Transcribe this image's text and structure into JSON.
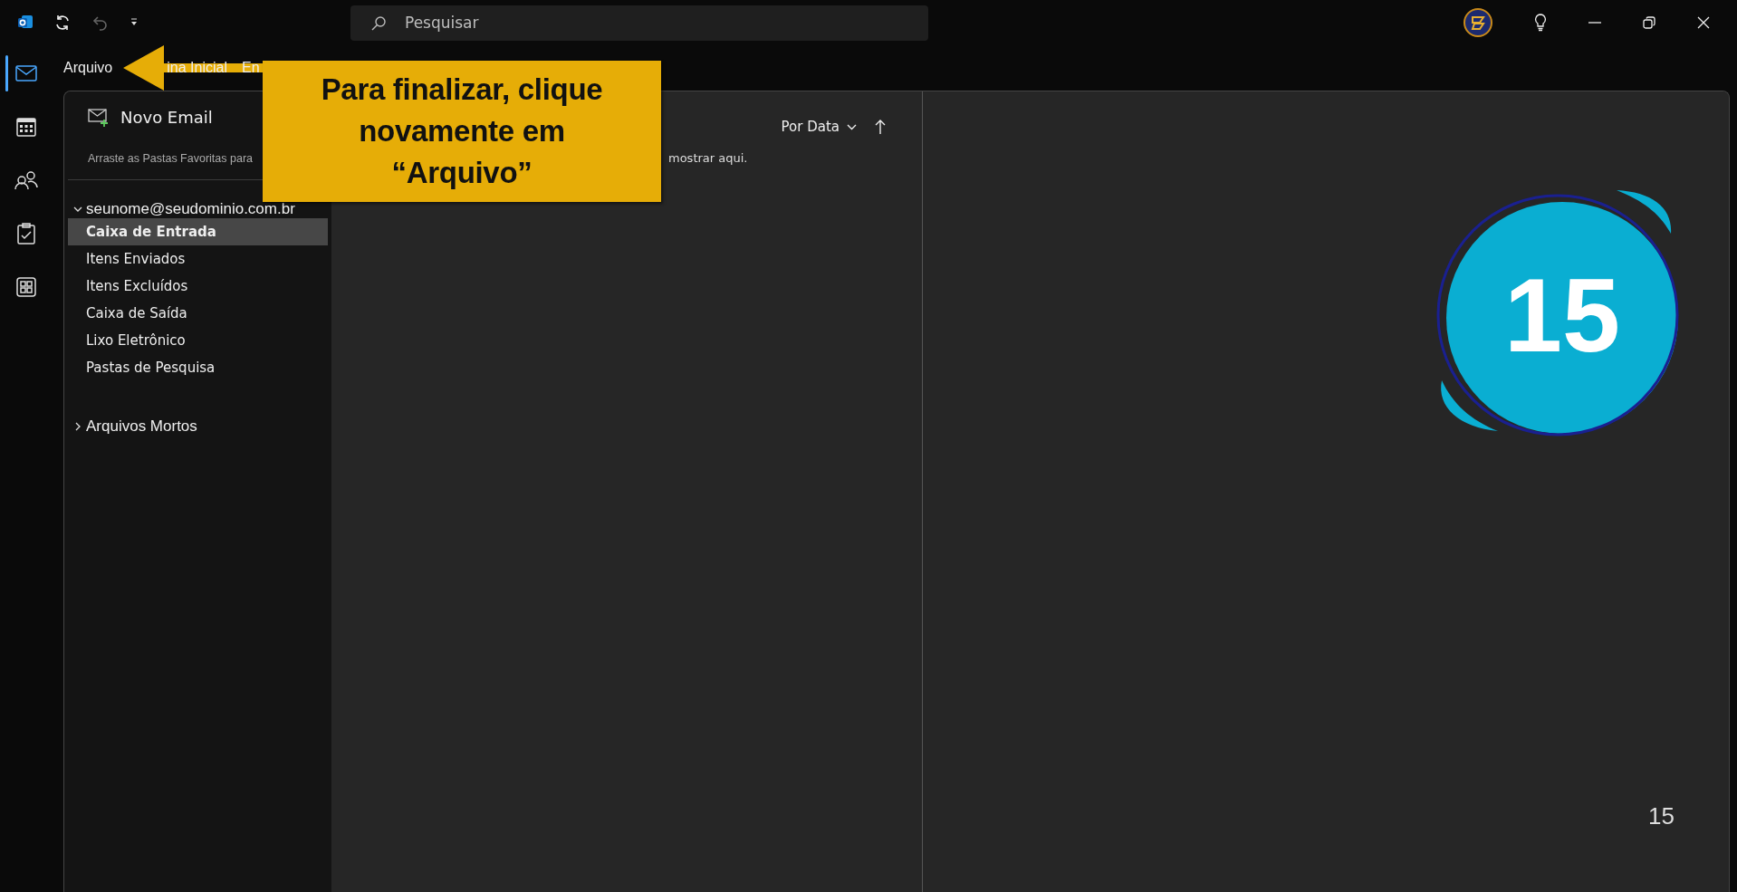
{
  "title_bar": {
    "search": {
      "placeholder": "Pesquisar"
    }
  },
  "nav_rail": [
    {
      "kind": "mail",
      "selected": true
    },
    {
      "kind": "calendar",
      "selected": false
    },
    {
      "kind": "people",
      "selected": false
    },
    {
      "kind": "tasks",
      "selected": false
    },
    {
      "kind": "apps",
      "selected": false
    }
  ],
  "ribbon_tabs": [
    {
      "label": "Arquivo"
    },
    {
      "label": "ina Inicial"
    },
    {
      "label": "En"
    }
  ],
  "folder_pane": {
    "new_email": "Novo Email",
    "favorites_hint": "Arraste as Pastas Favoritas para",
    "accounts": [
      {
        "name": "seunome@seudominio.com.br",
        "expanded": true,
        "children": [
          {
            "label": "Caixa de Entrada",
            "selected": true
          },
          {
            "label": "Itens Enviados",
            "selected": false
          },
          {
            "label": "Itens Excluídos",
            "selected": false
          },
          {
            "label": "Caixa de Saída",
            "selected": false
          },
          {
            "label": "Lixo Eletrônico",
            "selected": false
          },
          {
            "label": "Pastas de Pesquisa",
            "selected": false
          }
        ]
      },
      {
        "name": "Arquivos Mortos",
        "expanded": false
      }
    ]
  },
  "message_list": {
    "sort": "Por Data",
    "empty_note": "mostrar aqui."
  },
  "callout": {
    "lines": [
      "Para finalizar, clique",
      "novamente em",
      "“Arquivo”"
    ]
  },
  "step_badge": "15",
  "page_number": "15"
}
